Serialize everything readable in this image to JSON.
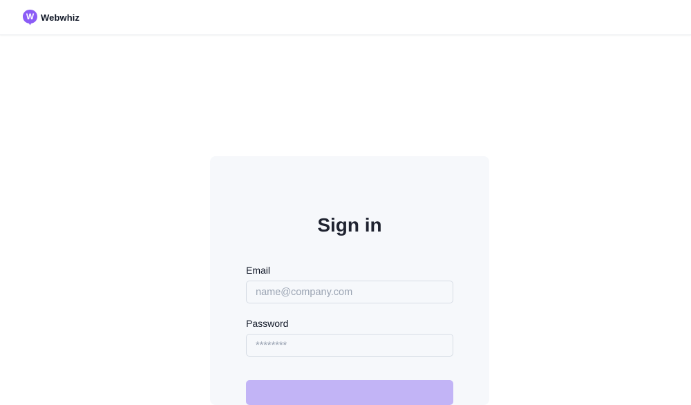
{
  "brand": {
    "name": "Webwhiz",
    "logo_letter": "W",
    "logo_color": "#8b5cf6"
  },
  "signin": {
    "title": "Sign in",
    "email_label": "Email",
    "email_placeholder": "name@company.com",
    "email_value": "",
    "password_label": "Password",
    "password_placeholder": "********",
    "password_value": "",
    "submit_color": "#c2b4f6"
  }
}
